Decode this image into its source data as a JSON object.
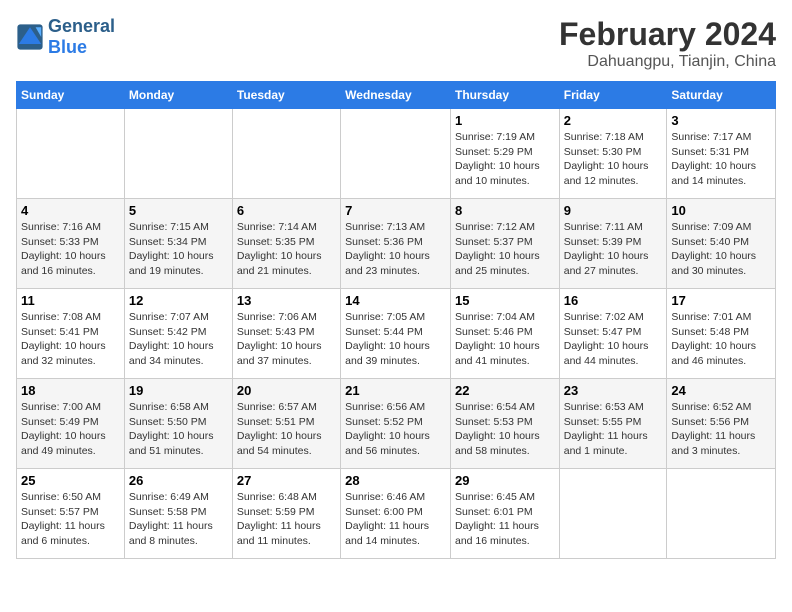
{
  "header": {
    "logo_line1": "General",
    "logo_line2": "Blue",
    "title": "February 2024",
    "subtitle": "Dahuangpu, Tianjin, China"
  },
  "days_of_week": [
    "Sunday",
    "Monday",
    "Tuesday",
    "Wednesday",
    "Thursday",
    "Friday",
    "Saturday"
  ],
  "weeks": [
    [
      {
        "num": "",
        "sunrise": "",
        "sunset": "",
        "daylight": ""
      },
      {
        "num": "",
        "sunrise": "",
        "sunset": "",
        "daylight": ""
      },
      {
        "num": "",
        "sunrise": "",
        "sunset": "",
        "daylight": ""
      },
      {
        "num": "",
        "sunrise": "",
        "sunset": "",
        "daylight": ""
      },
      {
        "num": "1",
        "sunrise": "Sunrise: 7:19 AM",
        "sunset": "Sunset: 5:29 PM",
        "daylight": "Daylight: 10 hours and 10 minutes."
      },
      {
        "num": "2",
        "sunrise": "Sunrise: 7:18 AM",
        "sunset": "Sunset: 5:30 PM",
        "daylight": "Daylight: 10 hours and 12 minutes."
      },
      {
        "num": "3",
        "sunrise": "Sunrise: 7:17 AM",
        "sunset": "Sunset: 5:31 PM",
        "daylight": "Daylight: 10 hours and 14 minutes."
      }
    ],
    [
      {
        "num": "4",
        "sunrise": "Sunrise: 7:16 AM",
        "sunset": "Sunset: 5:33 PM",
        "daylight": "Daylight: 10 hours and 16 minutes."
      },
      {
        "num": "5",
        "sunrise": "Sunrise: 7:15 AM",
        "sunset": "Sunset: 5:34 PM",
        "daylight": "Daylight: 10 hours and 19 minutes."
      },
      {
        "num": "6",
        "sunrise": "Sunrise: 7:14 AM",
        "sunset": "Sunset: 5:35 PM",
        "daylight": "Daylight: 10 hours and 21 minutes."
      },
      {
        "num": "7",
        "sunrise": "Sunrise: 7:13 AM",
        "sunset": "Sunset: 5:36 PM",
        "daylight": "Daylight: 10 hours and 23 minutes."
      },
      {
        "num": "8",
        "sunrise": "Sunrise: 7:12 AM",
        "sunset": "Sunset: 5:37 PM",
        "daylight": "Daylight: 10 hours and 25 minutes."
      },
      {
        "num": "9",
        "sunrise": "Sunrise: 7:11 AM",
        "sunset": "Sunset: 5:39 PM",
        "daylight": "Daylight: 10 hours and 27 minutes."
      },
      {
        "num": "10",
        "sunrise": "Sunrise: 7:09 AM",
        "sunset": "Sunset: 5:40 PM",
        "daylight": "Daylight: 10 hours and 30 minutes."
      }
    ],
    [
      {
        "num": "11",
        "sunrise": "Sunrise: 7:08 AM",
        "sunset": "Sunset: 5:41 PM",
        "daylight": "Daylight: 10 hours and 32 minutes."
      },
      {
        "num": "12",
        "sunrise": "Sunrise: 7:07 AM",
        "sunset": "Sunset: 5:42 PM",
        "daylight": "Daylight: 10 hours and 34 minutes."
      },
      {
        "num": "13",
        "sunrise": "Sunrise: 7:06 AM",
        "sunset": "Sunset: 5:43 PM",
        "daylight": "Daylight: 10 hours and 37 minutes."
      },
      {
        "num": "14",
        "sunrise": "Sunrise: 7:05 AM",
        "sunset": "Sunset: 5:44 PM",
        "daylight": "Daylight: 10 hours and 39 minutes."
      },
      {
        "num": "15",
        "sunrise": "Sunrise: 7:04 AM",
        "sunset": "Sunset: 5:46 PM",
        "daylight": "Daylight: 10 hours and 41 minutes."
      },
      {
        "num": "16",
        "sunrise": "Sunrise: 7:02 AM",
        "sunset": "Sunset: 5:47 PM",
        "daylight": "Daylight: 10 hours and 44 minutes."
      },
      {
        "num": "17",
        "sunrise": "Sunrise: 7:01 AM",
        "sunset": "Sunset: 5:48 PM",
        "daylight": "Daylight: 10 hours and 46 minutes."
      }
    ],
    [
      {
        "num": "18",
        "sunrise": "Sunrise: 7:00 AM",
        "sunset": "Sunset: 5:49 PM",
        "daylight": "Daylight: 10 hours and 49 minutes."
      },
      {
        "num": "19",
        "sunrise": "Sunrise: 6:58 AM",
        "sunset": "Sunset: 5:50 PM",
        "daylight": "Daylight: 10 hours and 51 minutes."
      },
      {
        "num": "20",
        "sunrise": "Sunrise: 6:57 AM",
        "sunset": "Sunset: 5:51 PM",
        "daylight": "Daylight: 10 hours and 54 minutes."
      },
      {
        "num": "21",
        "sunrise": "Sunrise: 6:56 AM",
        "sunset": "Sunset: 5:52 PM",
        "daylight": "Daylight: 10 hours and 56 minutes."
      },
      {
        "num": "22",
        "sunrise": "Sunrise: 6:54 AM",
        "sunset": "Sunset: 5:53 PM",
        "daylight": "Daylight: 10 hours and 58 minutes."
      },
      {
        "num": "23",
        "sunrise": "Sunrise: 6:53 AM",
        "sunset": "Sunset: 5:55 PM",
        "daylight": "Daylight: 11 hours and 1 minute."
      },
      {
        "num": "24",
        "sunrise": "Sunrise: 6:52 AM",
        "sunset": "Sunset: 5:56 PM",
        "daylight": "Daylight: 11 hours and 3 minutes."
      }
    ],
    [
      {
        "num": "25",
        "sunrise": "Sunrise: 6:50 AM",
        "sunset": "Sunset: 5:57 PM",
        "daylight": "Daylight: 11 hours and 6 minutes."
      },
      {
        "num": "26",
        "sunrise": "Sunrise: 6:49 AM",
        "sunset": "Sunset: 5:58 PM",
        "daylight": "Daylight: 11 hours and 8 minutes."
      },
      {
        "num": "27",
        "sunrise": "Sunrise: 6:48 AM",
        "sunset": "Sunset: 5:59 PM",
        "daylight": "Daylight: 11 hours and 11 minutes."
      },
      {
        "num": "28",
        "sunrise": "Sunrise: 6:46 AM",
        "sunset": "Sunset: 6:00 PM",
        "daylight": "Daylight: 11 hours and 14 minutes."
      },
      {
        "num": "29",
        "sunrise": "Sunrise: 6:45 AM",
        "sunset": "Sunset: 6:01 PM",
        "daylight": "Daylight: 11 hours and 16 minutes."
      },
      {
        "num": "",
        "sunrise": "",
        "sunset": "",
        "daylight": ""
      },
      {
        "num": "",
        "sunrise": "",
        "sunset": "",
        "daylight": ""
      }
    ]
  ]
}
